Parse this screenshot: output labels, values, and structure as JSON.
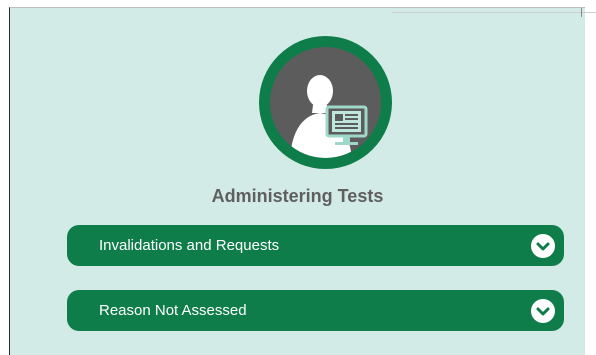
{
  "page": {
    "title": "Administering Tests"
  },
  "icons": {
    "hero": "user-at-computer-icon",
    "expand": "chevron-down-icon"
  },
  "accordion": {
    "items": [
      {
        "label": "Invalidations and Requests"
      },
      {
        "label": "Reason Not Assessed"
      }
    ]
  },
  "colors": {
    "brand_green": "#0e7d4a",
    "panel_bg": "#d3ebe6",
    "title_text": "#5f5f5f",
    "icon_bg": "#5c5c5c"
  }
}
